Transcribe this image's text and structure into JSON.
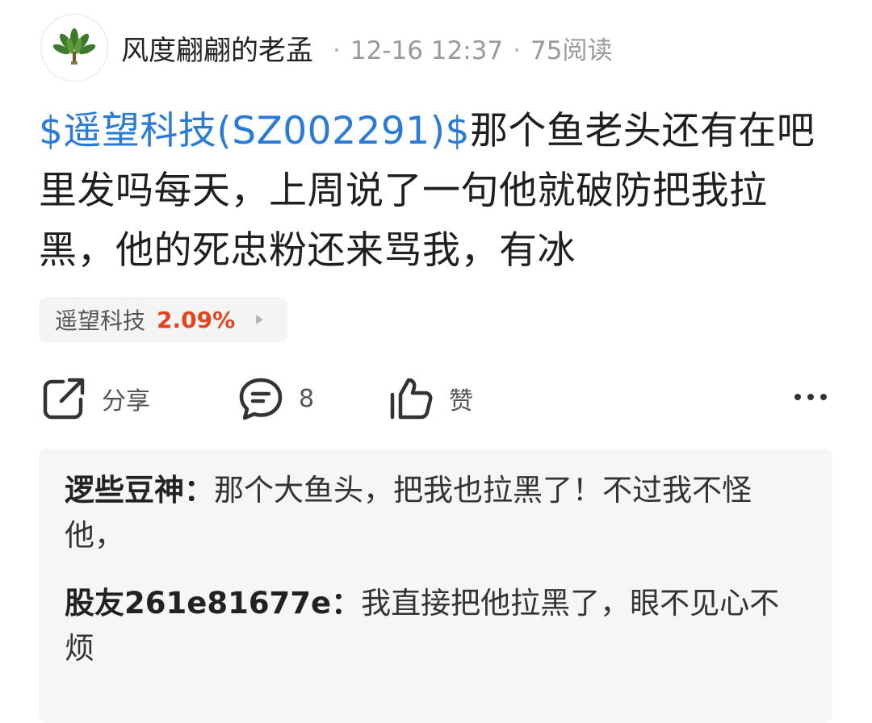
{
  "author": {
    "name": "风度翩翩的老孟",
    "time": "12-16 12:37",
    "reads": "75阅读",
    "separator": "·"
  },
  "post": {
    "stock_mention": "$遥望科技(SZ002291)$",
    "text": "那个鱼老头还有在吧里发吗每天，上周说了一句他就破防把我拉黑，他的死忠粉还来骂我，有冰"
  },
  "stock_tag": {
    "name": "遥望科技",
    "change": "2.09%"
  },
  "actions": {
    "share_label": "分享",
    "comment_count": "8",
    "like_label": "赞"
  },
  "comments": [
    {
      "user": "逻些豆神",
      "colon": "：",
      "text": "那个大鱼头，把我也拉黑了！不过我不怪他，"
    },
    {
      "user": "股友261e81677e",
      "colon": "：",
      "text": "我直接把他拉黑了，眼不见心不烦"
    }
  ],
  "colors": {
    "link": "#2a7ad6",
    "up": "#e0441e"
  },
  "icons": [
    "plant-avatar-icon",
    "share-icon",
    "comment-icon",
    "thumbs-up-icon",
    "more-icon"
  ]
}
